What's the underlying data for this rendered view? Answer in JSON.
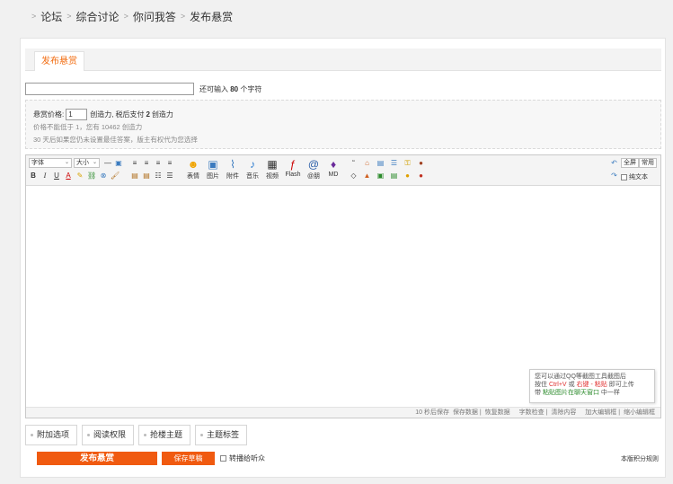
{
  "breadcrumb": [
    "论坛",
    "综合讨论",
    "你问我答",
    "发布悬赏"
  ],
  "tab": "发布悬赏",
  "title_hint": {
    "prefix": "还可输入",
    "count": "80",
    "suffix": "个字符"
  },
  "reward": {
    "label": "悬赏价格:",
    "value": "1",
    "unit": "创造力,",
    "tax_prefix": "税后支付",
    "tax_value": "2",
    "tax_unit": "创造力",
    "note1": "价格不能低于 1，您有 10462 创造力",
    "note2": "30 天后如果您仍未设置最佳答案，版主有权代为您选择"
  },
  "toolbar": {
    "font": "字体",
    "size": "大小",
    "emoji": "表情",
    "image": "图片",
    "attach": "附件",
    "music": "音乐",
    "video": "视频",
    "flash": "Flash",
    "mention": "@朋",
    "md": "MD",
    "fullscreen": "全屏",
    "common": "常用",
    "plaintext": "纯文本"
  },
  "tooltip": {
    "line1": "您可以通过QQ等截图工具截图后",
    "line2_a": "按住",
    "line2_b": "Ctrl+V",
    "line2_c": "或",
    "line2_d": "右键 - 粘贴",
    "line2_e": "即可上传",
    "line3_a": "带",
    "line3_b": "粘贴图片在聊天窗口",
    "line3_c": "中一样"
  },
  "statusbar": {
    "autosave": "10 秒后保存",
    "save": "保存数据",
    "restore": "恢复数据",
    "count": "字数检查",
    "clear": "清除内容",
    "enlarge": "加大编辑框",
    "shrink": "缩小编辑框"
  },
  "options": [
    "附加选项",
    "阅读权限",
    "抢楼主题",
    "主题标签"
  ],
  "actions": {
    "submit": "发布悬赏",
    "draft": "保存草稿",
    "repost": "转播给听众",
    "rules": "本版积分规则"
  }
}
